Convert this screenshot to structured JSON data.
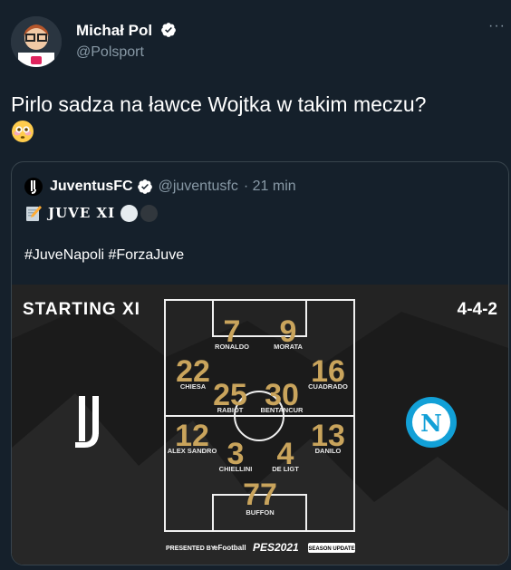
{
  "tweet": {
    "author_name": "Michał Pol",
    "handle": "@Polsport",
    "text": "Pirlo sadza na ławce Wojtka w takim meczu?",
    "more_label": "···"
  },
  "quote": {
    "author_name": "JuventusFC",
    "handle": "@juventusfc",
    "time": "· 21 min",
    "line1": "JUVE XI",
    "hashtags": "#JuveNapoli #ForzaJuve"
  },
  "lineup": {
    "title": "STARTING XI",
    "formation": "4-4-2",
    "sponsor_prefix": "PRESENTED BY",
    "sponsor_brand": "eFootball",
    "sponsor_game": "PES2021",
    "sponsor_badge": "SEASON UPDATE",
    "players": [
      {
        "number": "7",
        "name": "RONALDO"
      },
      {
        "number": "9",
        "name": "MORATA"
      },
      {
        "number": "22",
        "name": "CHIESA"
      },
      {
        "number": "25",
        "name": "RABIOT"
      },
      {
        "number": "30",
        "name": "BENTANCUR"
      },
      {
        "number": "16",
        "name": "CUADRADO"
      },
      {
        "number": "12",
        "name": "ALEX SANDRO"
      },
      {
        "number": "3",
        "name": "CHIELLINI"
      },
      {
        "number": "4",
        "name": "DE LIGT"
      },
      {
        "number": "13",
        "name": "DANILO"
      },
      {
        "number": "77",
        "name": "BUFFON"
      }
    ]
  },
  "colors": {
    "background": "#15202b",
    "secondary_text": "#8899a6",
    "border": "#38444d",
    "gold": "#c9a45c",
    "verified": "#1da1f2",
    "napoli_blue": "#12a0d7"
  }
}
